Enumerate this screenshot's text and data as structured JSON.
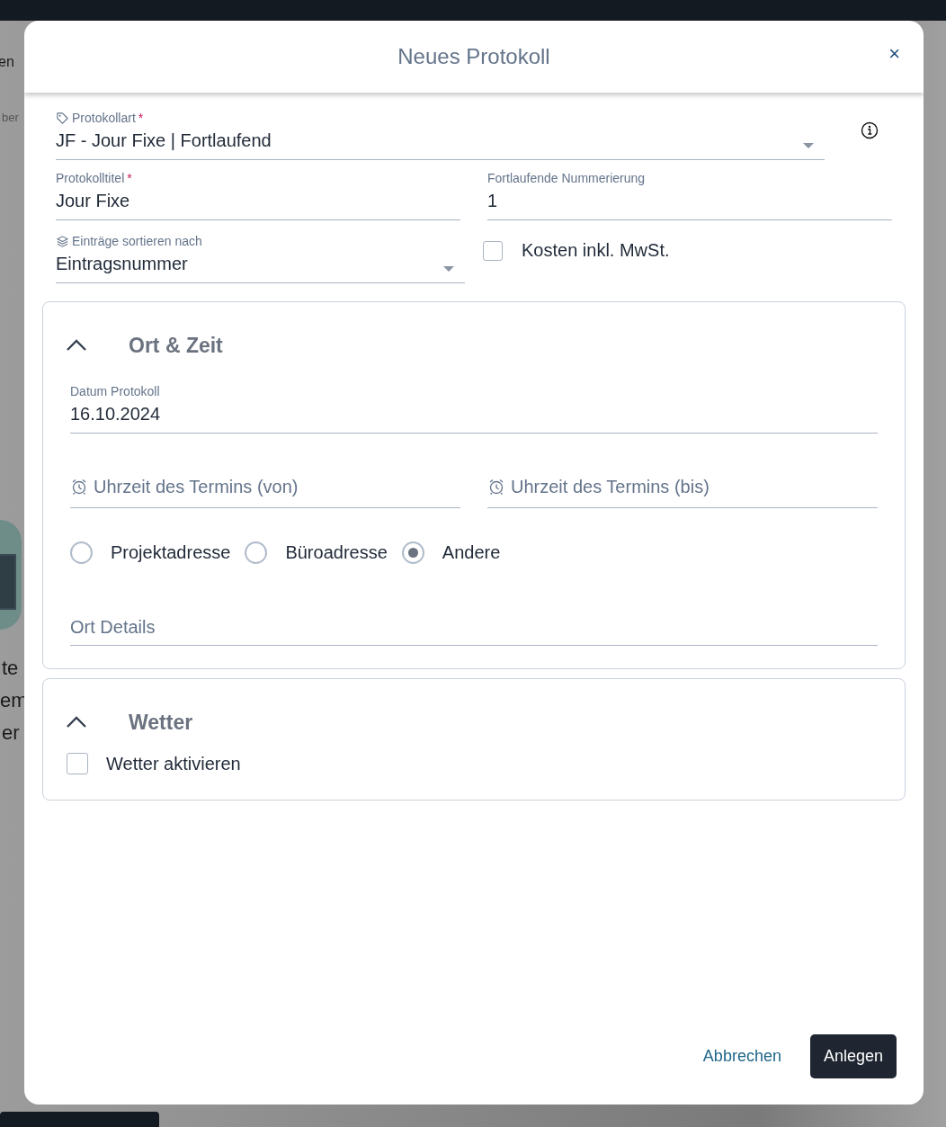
{
  "background": {
    "fragments": [
      {
        "text": "en",
        "kind": "nav"
      },
      {
        "text": "ber",
        "kind": "small"
      },
      {
        "text": "te",
        "kind": "line"
      },
      {
        "text": "em",
        "kind": "line"
      },
      {
        "text": "er",
        "kind": "line"
      }
    ]
  },
  "dialog": {
    "title": "Neues Protokoll",
    "close": "×"
  },
  "protocol_type": {
    "label": "Protokollart",
    "required_mark": "*",
    "value": "JF - Jour Fixe | Fortlaufend"
  },
  "title_field": {
    "label": "Protokolltitel",
    "required_mark": "*",
    "value": "Jour Fixe"
  },
  "numbering": {
    "label": "Fortlaufende Nummerierung",
    "value": "1"
  },
  "sort": {
    "label": "Einträge sortieren nach",
    "value": "Eintragsnummer"
  },
  "costs_checkbox": {
    "label": "Kosten inkl. MwSt.",
    "checked": false
  },
  "location_time": {
    "title": "Ort & Zeit",
    "expanded": true,
    "date": {
      "label": "Datum Protokoll",
      "value": "16.10.2024"
    },
    "time_from": {
      "placeholder": "Uhrzeit des Termins (von)"
    },
    "time_to": {
      "placeholder": "Uhrzeit des Termins (bis)"
    },
    "address_options": [
      {
        "label": "Projektadresse",
        "selected": false
      },
      {
        "label": "Büroadresse",
        "selected": false
      },
      {
        "label": "Andere",
        "selected": true
      }
    ],
    "location_details": {
      "placeholder": "Ort Details"
    }
  },
  "weather": {
    "title": "Wetter",
    "expanded": true,
    "enable_checkbox": {
      "label": "Wetter aktivieren",
      "checked": false
    }
  },
  "buttons": {
    "cancel": "Abbrechen",
    "create": "Anlegen"
  }
}
